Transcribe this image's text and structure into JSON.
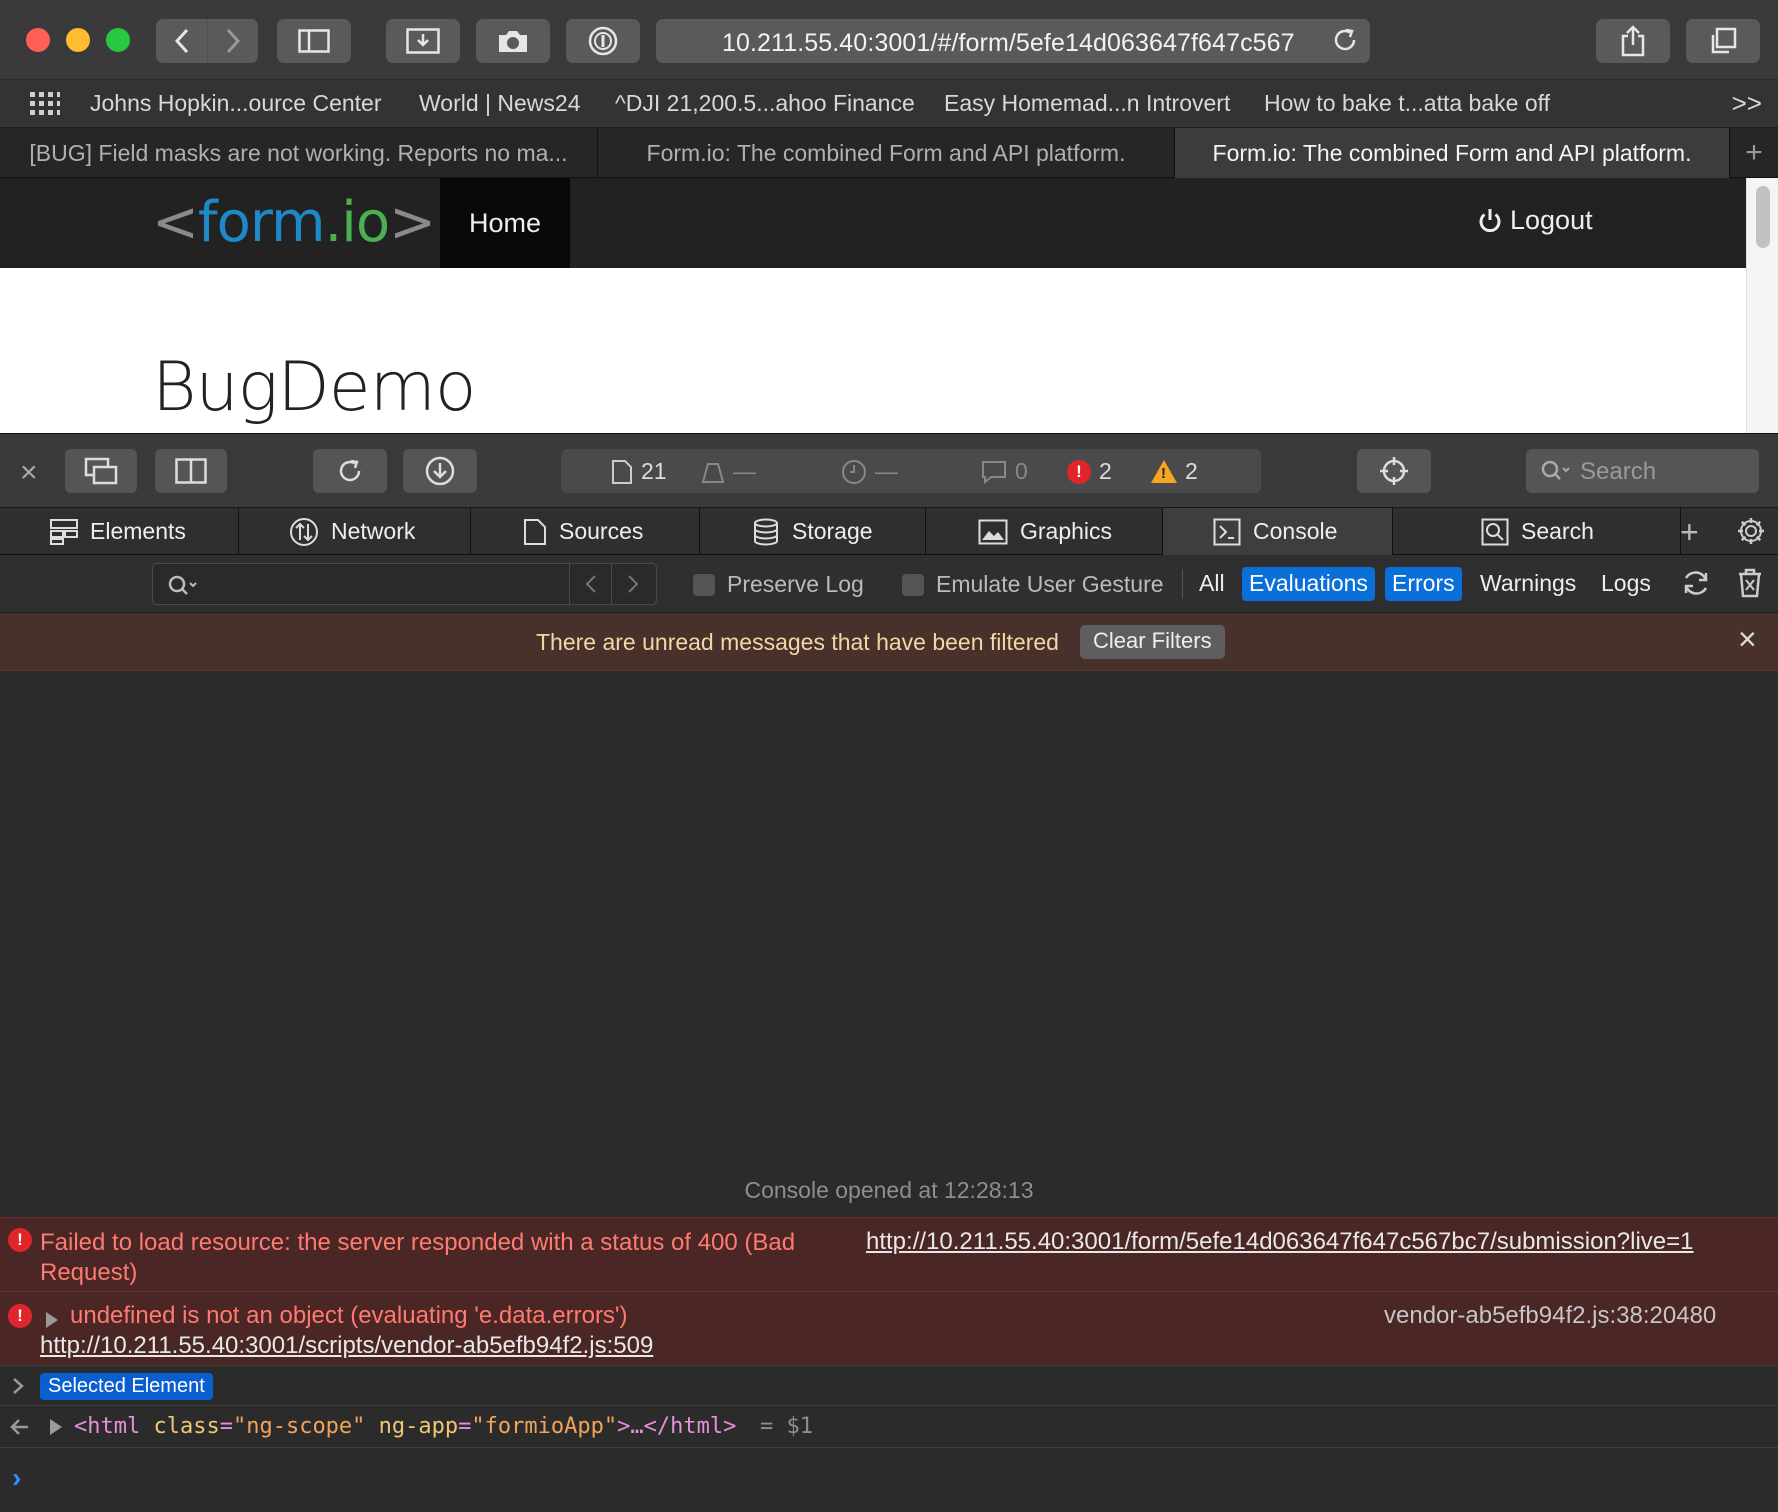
{
  "browser": {
    "url": "10.211.55.40:3001/#/form/5efe14d063647f647c567",
    "favorites": [
      "Johns Hopkin...ource Center",
      "World | News24",
      "^DJI 21,200.5...ahoo Finance",
      "Easy Homemad...n Introvert",
      "How to bake t...atta bake off"
    ],
    "favorites_more": ">>",
    "tabs": [
      "[BUG] Field masks are not working. Reports no ma...",
      "Form.io: The combined Form and API platform.",
      "Form.io: The combined Form and API platform."
    ],
    "active_tab_index": 2
  },
  "page": {
    "logo": {
      "lt": "<",
      "form": "form",
      "io": ".io",
      "gt": ">"
    },
    "nav_home": "Home",
    "nav_logout": "Logout",
    "title": "BugDemo"
  },
  "inspector": {
    "activity": {
      "resources": "21",
      "size": "—",
      "time": "—",
      "logs": "0",
      "errors": "2",
      "warnings": "2"
    },
    "search_placeholder": "Search",
    "tabs": [
      "Elements",
      "Network",
      "Sources",
      "Storage",
      "Graphics",
      "Console",
      "Search"
    ],
    "active_tab": "Console",
    "filter": {
      "preserve_log": "Preserve Log",
      "emulate_gesture": "Emulate User Gesture",
      "levels": [
        "All",
        "Evaluations",
        "Errors",
        "Warnings",
        "Logs"
      ],
      "active_levels": [
        "Evaluations",
        "Errors"
      ]
    },
    "banner": {
      "text": "There are unread messages that have been filtered",
      "clear_button": "Clear Filters"
    }
  },
  "console": {
    "opened_text": "Console opened at 12:28:13",
    "error1": {
      "text_line1": "Failed to load resource: the server responded with a status of 400 (Bad",
      "text_line2": "Request)",
      "link": "http://10.211.55.40:3001/form/5efe14d063647f647c567bc7/submission?live=1"
    },
    "error2": {
      "text": "undefined is not an object (evaluating 'e.data.errors')",
      "source": "vendor-ab5efb94f2.js:38:20480",
      "link": "http://10.211.55.40:3001/scripts/vendor-ab5efb94f2.js:509"
    },
    "selected_element_label": "Selected Element",
    "eval": {
      "tag_open": "<html",
      "attr1_name": "class",
      "attr1_value": "\"ng-scope\"",
      "attr2_name": "ng-app",
      "attr2_value": "\"formioApp\"",
      "tag_tail": ">…</html>",
      "result": "= $1"
    }
  }
}
